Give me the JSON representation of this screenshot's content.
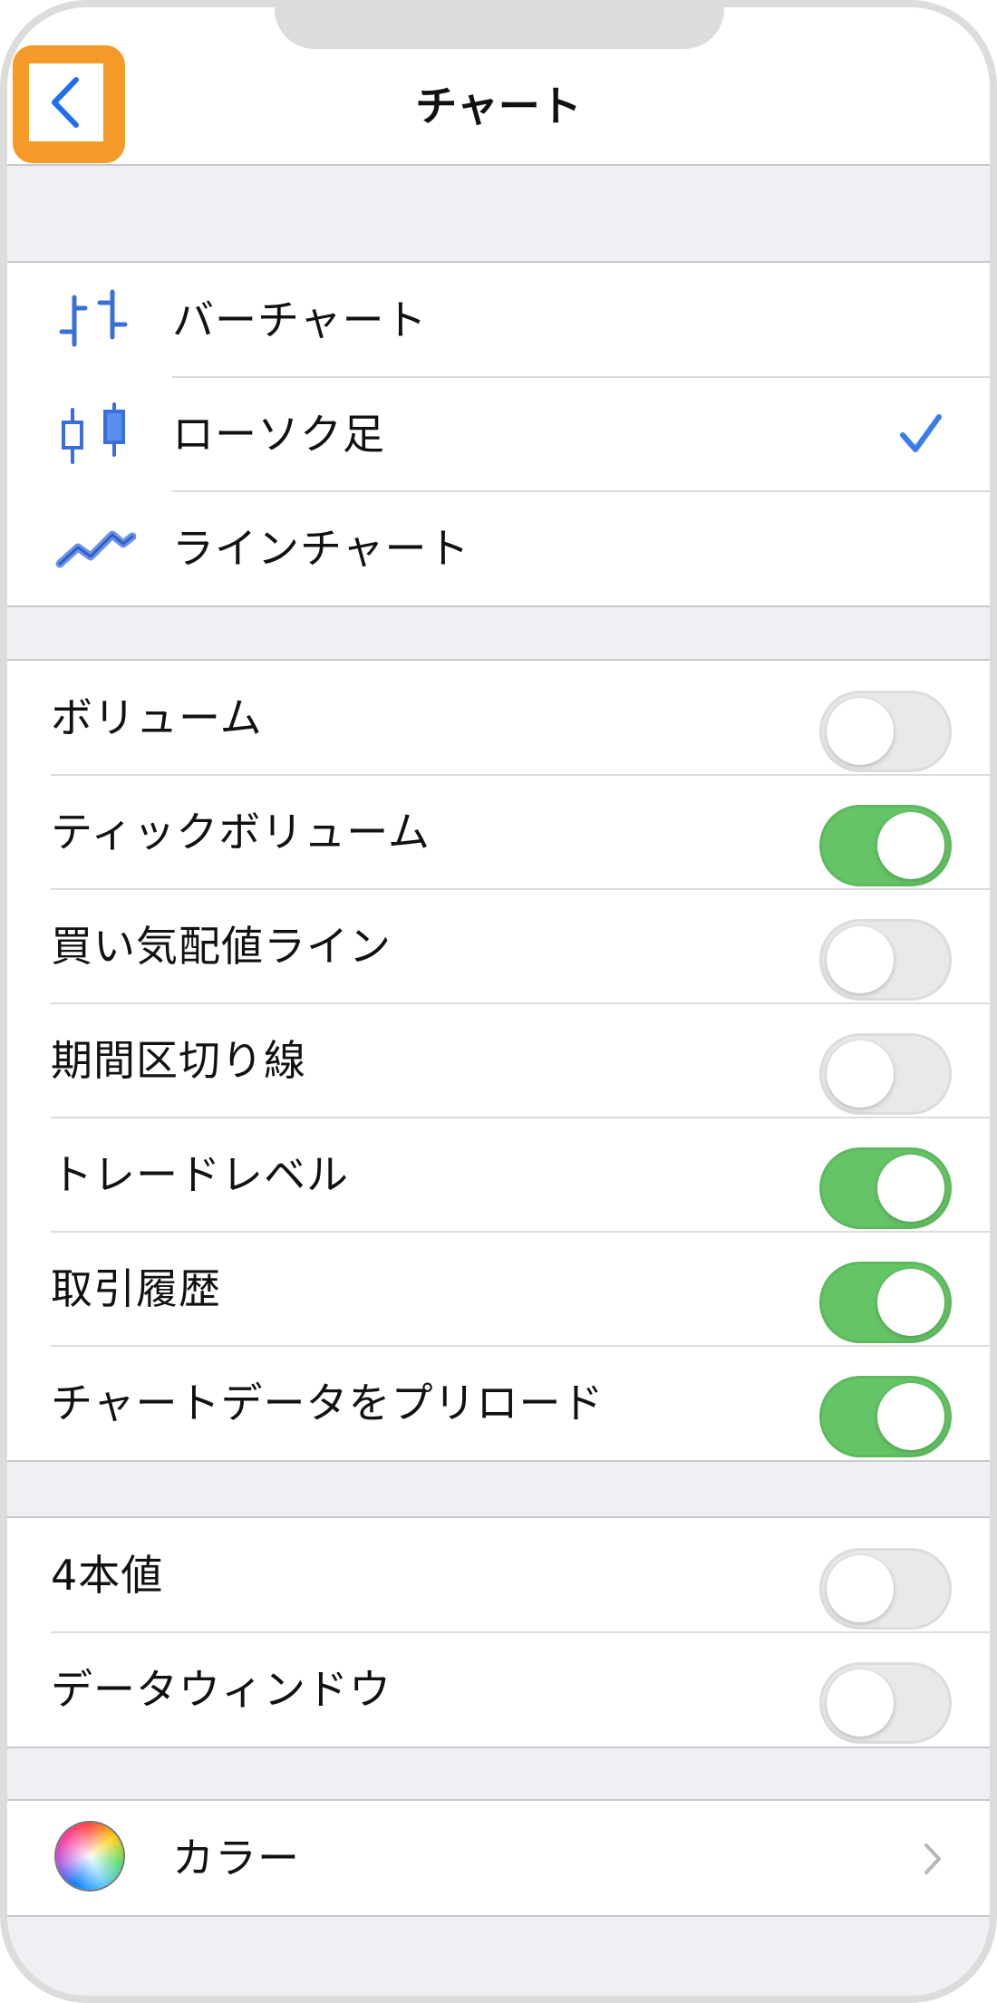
{
  "header": {
    "title": "チャート"
  },
  "chart_types": [
    {
      "label": "バーチャート",
      "icon": "bar-chart-icon",
      "selected": false
    },
    {
      "label": "ローソク足",
      "icon": "candlestick-icon",
      "selected": true
    },
    {
      "label": "ラインチャート",
      "icon": "line-chart-icon",
      "selected": false
    }
  ],
  "display_options": [
    {
      "label": "ボリューム",
      "on": false
    },
    {
      "label": "ティックボリューム",
      "on": true
    },
    {
      "label": "買い気配値ライン",
      "on": false
    },
    {
      "label": "期間区切り線",
      "on": false
    },
    {
      "label": "トレードレベル",
      "on": true
    },
    {
      "label": "取引履歴",
      "on": true
    },
    {
      "label": "チャートデータをプリロード",
      "on": true
    }
  ],
  "extra_options": [
    {
      "label": "4本値",
      "on": false
    },
    {
      "label": "データウィンドウ",
      "on": false
    }
  ],
  "color_item": {
    "label": "カラー",
    "icon": "color-wheel-icon"
  },
  "colors": {
    "accent": "#3b7bf0",
    "toggle_on": "#65c466",
    "highlight": "#f39a28"
  }
}
